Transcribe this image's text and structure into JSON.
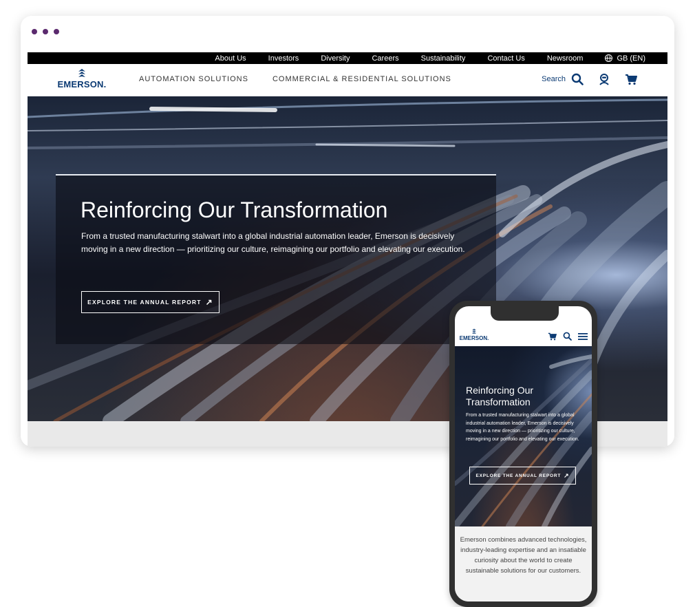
{
  "browser": {
    "window_dots": 3
  },
  "utility_nav": {
    "links": [
      "About Us",
      "Investors",
      "Diversity",
      "Careers",
      "Sustainability",
      "Contact Us",
      "Newsroom"
    ],
    "region": "GB (EN)"
  },
  "header": {
    "logo_text": "EMERSON.",
    "nav": [
      "AUTOMATION SOLUTIONS",
      "COMMERCIAL & RESIDENTIAL SOLUTIONS"
    ],
    "search_label": "Search",
    "icons": [
      "search-icon",
      "user-icon",
      "cart-icon"
    ]
  },
  "hero": {
    "title": "Reinforcing Our Transformation",
    "text": "From a trusted manufacturing stalwart into a global industrial automation leader, Emerson is decisively moving in a new direction — prioritizing our culture, reimagining our portfolio and elevating our execution.",
    "cta": "EXPLORE THE ANNUAL REPORT",
    "cta_arrow": "↗"
  },
  "mobile": {
    "logo_text": "EMERSON.",
    "icons": [
      "cart-icon",
      "search-icon",
      "menu-icon"
    ],
    "hero_title": "Reinforcing Our Transformation",
    "hero_text": "From a trusted manufacturing stalwart into a global industrial automation leader, Emerson is decisively moving in a new direction — prioritizing our culture, reimagining our portfolio and elevating our execution.",
    "cta": "EXPLORE THE ANNUAL REPORT",
    "about": "Emerson combines advanced technologies, industry-leading expertise and an insatiable curiosity about the world to create sustainable solutions for our customers."
  },
  "colors": {
    "brand_blue": "#0b3a73",
    "window_dots": "#5b2a6e",
    "utility_bar": "#000000"
  }
}
